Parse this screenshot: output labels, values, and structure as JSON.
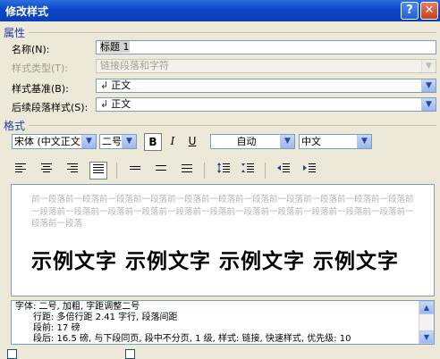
{
  "window": {
    "title": "修改样式"
  },
  "properties": {
    "section_label": "属性",
    "name_label": "名称(N):",
    "name_value": "标题 1",
    "style_type_label": "样式类型(T):",
    "style_type_value": "链接段落和字符",
    "based_on_label": "样式基准(B):",
    "based_on_value": "正文",
    "next_style_label": "后续段落样式(S):",
    "next_style_value": "正文"
  },
  "format": {
    "section_label": "格式",
    "font": "宋体 (中文正文",
    "size": "二号",
    "bold": "B",
    "italic": "I",
    "underline": "U",
    "color": "自动",
    "script": "中文"
  },
  "preview": {
    "previous_paragraph": "前一段落前一段落前一段落前一段落前一段落前一段落前一段落前一段落前一段落前一段落前一段落前一段落前一段落前一段落前一段落前一段落前一段落前一段落前一段落前一段落前一段落前一段落前一段落前一段落",
    "sample_text": "示例文字 示例文字 示例文字 示例文字"
  },
  "description": {
    "line1": "字体: 二号, 加粗, 字距调整二号",
    "line2": "行距: 多倍行距 2.41 字行, 段落间距",
    "line3": "段前: 17 磅",
    "line4": "段后: 16.5 磅, 与下段同页, 段中不分页, 1 级, 样式: 链接, 快速样式, 优先级: 10"
  },
  "icons": {
    "help": "help-icon",
    "close": "close-icon",
    "align_left": "align-left-icon",
    "align_center": "align-center-icon",
    "align_right": "align-right-icon",
    "justify": "justify-icon",
    "line_single": "single-spacing-icon",
    "line_onehalf": "one-half-spacing-icon",
    "line_double": "double-spacing-icon",
    "space_before_inc": "increase-paragraph-spacing-icon",
    "space_before_dec": "decrease-paragraph-spacing-icon",
    "indent_dec": "decrease-indent-icon",
    "indent_inc": "increase-indent-icon"
  },
  "colors": {
    "title_bar": "#0a46c7",
    "section_label": "#1b3ea8",
    "dialog_bg": "#ece9d8"
  }
}
